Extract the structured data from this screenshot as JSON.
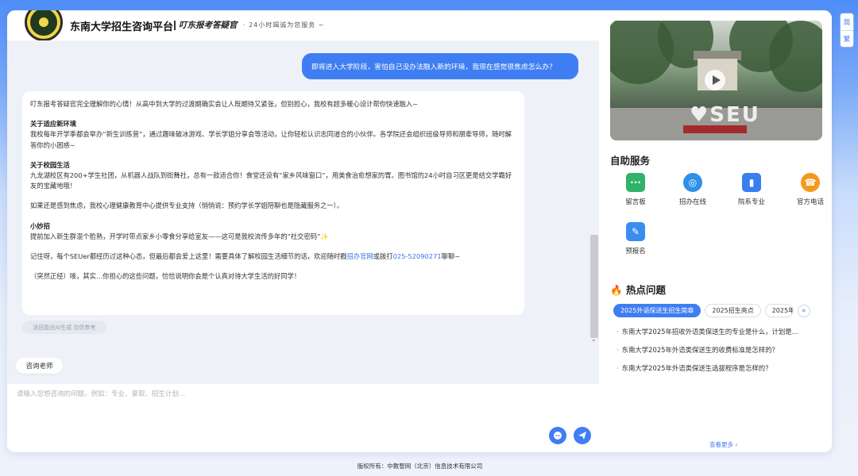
{
  "header": {
    "title": "东南大学招生咨询平台",
    "subtitle": "叮东报考答疑官",
    "tagline": "· 24小时竭诚为您服务 ~"
  },
  "chat": {
    "user_message": "即将进入大学阶段，害怕自己没办法融入新的环境，我现在感觉很焦虑怎么办？",
    "bot": {
      "intro": "叮东报考答疑官完全理解你的心情！从高中到大学的过渡期确实会让人既期待又紧张，但别担心，我校有超多暖心设计帮你快速融入~",
      "s1_title": "关于适应新环境",
      "s1_body": "我校每年开学季都会举办“新生训练营”，通过趣味破冰游戏、学长学姐分享会等活动，让你轻松认识志同道合的小伙伴。各学院还会组织班级导师和朋辈导师，随时解答你的小困惑~",
      "s2_title": "关于校园生活",
      "s2_body": "九龙湖校区有200+学生社团，从机器人战队到街舞社，总有一款适合你！食堂还设有“家乡风味窗口”，用美食治愈想家的胃。图书馆的24小时自习区更是结交学霸好友的宝藏地哦！",
      "s3_body": "如果还是感到焦虑，我校心理健康教育中心提供专业支持（悄悄说：预约学长学姐陪聊也是隐藏服务之一）。",
      "s4_title": "小妙招",
      "s4_body": "提前加入新生群混个脸熟，开学时带点家乡小零食分享给室友——这可是我校流传多年的“社交密码”✨",
      "s5_pre": "记住呀，每个SEUer都经历过这种心态，但最后都会爱上这里！需要具体了解校园生活细节的话，欢迎随时戳",
      "s5_link1": "招办官网",
      "s5_mid": "或拨打",
      "s5_link2": "025-52090271",
      "s5_post": "聊聊~",
      "outro": "（突然正经）咳，其实…你担心的这些问题，恰恰说明你会是个认真对待大学生活的好同学！"
    },
    "ai_note": "该回复由AI生成 仅供参考",
    "consult_button": "咨询老师",
    "input_placeholder": "请输入您想咨询的问题，例如：专业、录取、招生计划..."
  },
  "sidebar": {
    "self_service_title": "自助服务",
    "services": [
      {
        "label": "留言板",
        "icon": "message-board-icon",
        "color": "#2fb36a"
      },
      {
        "label": "招办在线",
        "icon": "admissions-online-icon",
        "color": "#2f8fea"
      },
      {
        "label": "院系专业",
        "icon": "departments-icon",
        "color": "#3a7ff0"
      },
      {
        "label": "官方电话",
        "icon": "phone-icon",
        "color": "#f39a1e"
      },
      {
        "label": "预报名",
        "icon": "pre-registration-icon",
        "color": "#3a8df0"
      }
    ],
    "hot_title": "热点问题",
    "hot_tabs": [
      "2025外语保送生招生简章",
      "2025招生亮点",
      "2025年"
    ],
    "questions": [
      "东南大学2025年招收外语类保送生的专业是什么，计划是...",
      "东南大学2025年外语类保送生的收费标准是怎样的？",
      "东南大学2025年外语类保送生选拔程序是怎样的？"
    ],
    "see_more": "查看更多 ›"
  },
  "lang": {
    "simplified": "简",
    "traditional": "繁"
  },
  "footer": "版权所有：中教智网（北京）信息技术有限公司",
  "colors": {
    "accent": "#3f7ef2",
    "chat_bg": "#eef2f8"
  }
}
